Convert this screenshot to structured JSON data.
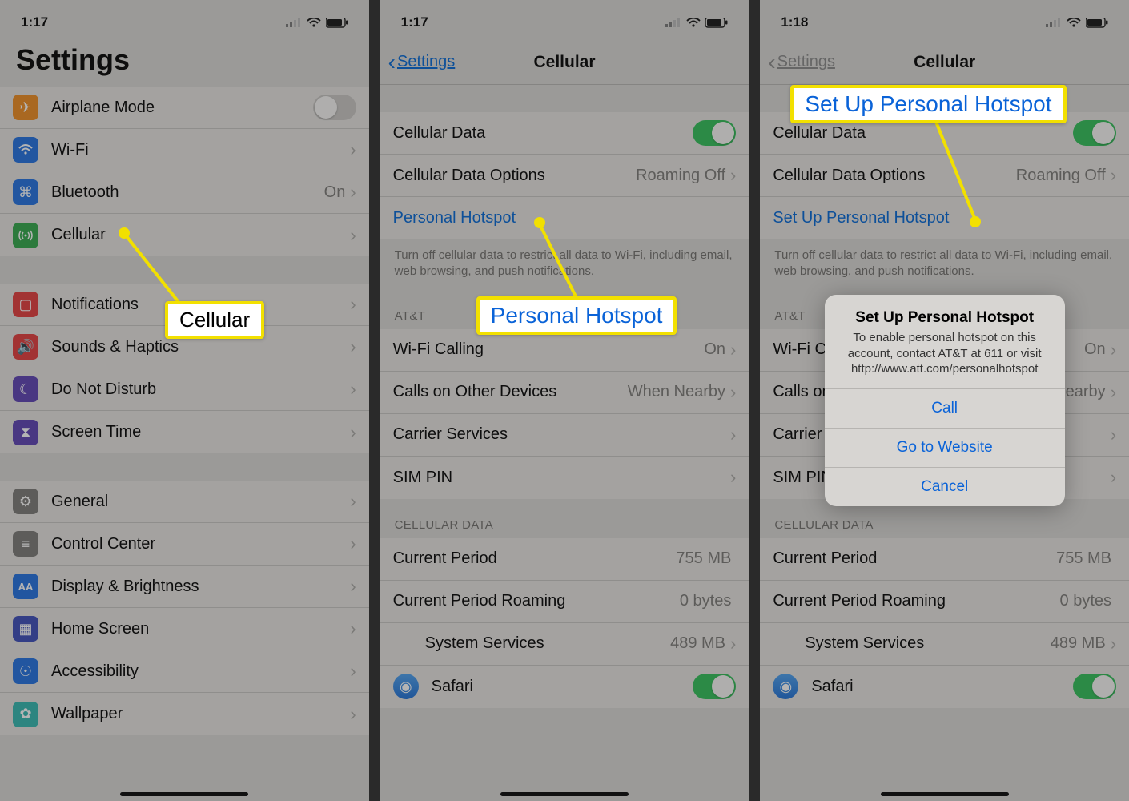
{
  "statusbar": {
    "time1": "1:17",
    "time2": "1:17",
    "time3": "1:18"
  },
  "screen1": {
    "title": "Settings",
    "rows": {
      "airplane": "Airplane Mode",
      "wifi": "Wi-Fi",
      "bluetooth": "Bluetooth",
      "bluetooth_val": "On",
      "cellular": "Cellular",
      "notifications": "Notifications",
      "sounds": "Sounds & Haptics",
      "dnd": "Do Not Disturb",
      "screentime": "Screen Time",
      "general": "General",
      "controlcenter": "Control Center",
      "display": "Display & Brightness",
      "homescreen": "Home Screen",
      "accessibility": "Accessibility",
      "wallpaper": "Wallpaper"
    },
    "callout": "Cellular"
  },
  "screen2": {
    "back": "Settings",
    "title": "Cellular",
    "rows": {
      "cellulardata": "Cellular Data",
      "cellopts": "Cellular Data Options",
      "cellopts_val": "Roaming Off",
      "hotspot": "Personal Hotspot",
      "wificalling": "Wi-Fi Calling",
      "wificalling_val": "On",
      "callsother": "Calls on Other Devices",
      "callsother_val": "When Nearby",
      "carrier": "Carrier Services",
      "simpin": "SIM PIN",
      "currentperiod": "Current Period",
      "currentperiod_val": "755 MB",
      "roaming": "Current Period Roaming",
      "roaming_val": "0 bytes",
      "sysservices": "System Services",
      "sysservices_val": "489 MB",
      "safari": "Safari"
    },
    "note": "Turn off cellular data to restrict all data to Wi-Fi, including email, web browsing, and push notifications.",
    "head_att": "AT&T",
    "head_cell": "CELLULAR DATA",
    "callout": "Personal Hotspot"
  },
  "screen3": {
    "back": "Settings",
    "title": "Cellular",
    "rows": {
      "cellulardata": "Cellular Data",
      "cellopts": "Cellular Data Options",
      "cellopts_val": "Roaming Off",
      "hotspot": "Set Up Personal Hotspot",
      "wificalling": "Wi-Fi Calling",
      "wificalling_val": "On",
      "callsother": "Calls on Other Devices",
      "callsother_val": "When Nearby",
      "carrier": "Carrier Services",
      "simpin": "SIM PIN",
      "currentperiod": "Current Period",
      "currentperiod_val": "755 MB",
      "roaming": "Current Period Roaming",
      "roaming_val": "0 bytes",
      "sysservices": "System Services",
      "sysservices_val": "489 MB",
      "safari": "Safari"
    },
    "note": "Turn off cellular data to restrict all data to Wi-Fi, including email, web browsing, and push notifications.",
    "head_att": "AT&T",
    "head_cell": "CELLULAR DATA",
    "callout": "Set Up Personal Hotspot",
    "alert": {
      "title": "Set Up Personal Hotspot",
      "msg": "To enable personal hotspot on this account, contact AT&T at 611 or visit http://www.att.com/personalhotspot",
      "call": "Call",
      "web": "Go to Website",
      "cancel": "Cancel"
    }
  }
}
